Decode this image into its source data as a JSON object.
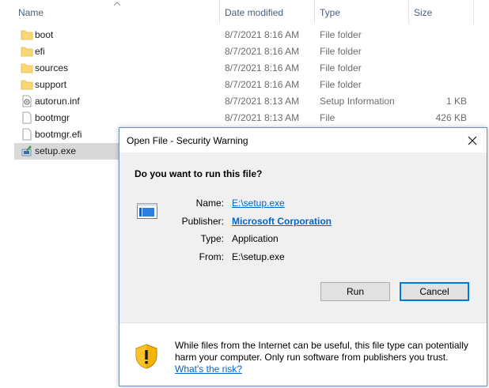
{
  "explorer": {
    "columns": {
      "name": "Name",
      "date": "Date modified",
      "type": "Type",
      "size": "Size"
    },
    "files": [
      {
        "name": "boot",
        "date": "8/7/2021 8:16 AM",
        "type": "File folder",
        "size": "",
        "icon": "folder-icon"
      },
      {
        "name": "efi",
        "date": "8/7/2021 8:16 AM",
        "type": "File folder",
        "size": "",
        "icon": "folder-icon"
      },
      {
        "name": "sources",
        "date": "8/7/2021 8:16 AM",
        "type": "File folder",
        "size": "",
        "icon": "folder-icon"
      },
      {
        "name": "support",
        "date": "8/7/2021 8:16 AM",
        "type": "File folder",
        "size": "",
        "icon": "folder-icon"
      },
      {
        "name": "autorun.inf",
        "date": "8/7/2021 8:13 AM",
        "type": "Setup Information",
        "size": "1 KB",
        "icon": "setup-info-icon"
      },
      {
        "name": "bootmgr",
        "date": "8/7/2021 8:13 AM",
        "type": "File",
        "size": "426 KB",
        "icon": "file-icon"
      },
      {
        "name": "bootmgr.efi",
        "date": "",
        "type": "",
        "size": "",
        "icon": "file-icon"
      },
      {
        "name": "setup.exe",
        "date": "",
        "type": "",
        "size": "",
        "icon": "setup-exe-icon"
      }
    ]
  },
  "dialog": {
    "title": "Open File - Security Warning",
    "question": "Do you want to run this file?",
    "fields": {
      "name_label": "Name:",
      "name_value": "E:\\setup.exe",
      "publisher_label": "Publisher:",
      "publisher_value": "Microsoft Corporation",
      "type_label": "Type:",
      "type_value": "Application",
      "from_label": "From:",
      "from_value": "E:\\setup.exe"
    },
    "run_label": "Run",
    "cancel_label": "Cancel",
    "warning_text": "While files from the Internet can be useful, this file type can potentially harm your computer. Only run software from publishers you trust.",
    "warning_link": "What's the risk?"
  },
  "colors": {
    "folder": "#f8d775",
    "link": "#0066cc",
    "accent": "#0078d7"
  }
}
